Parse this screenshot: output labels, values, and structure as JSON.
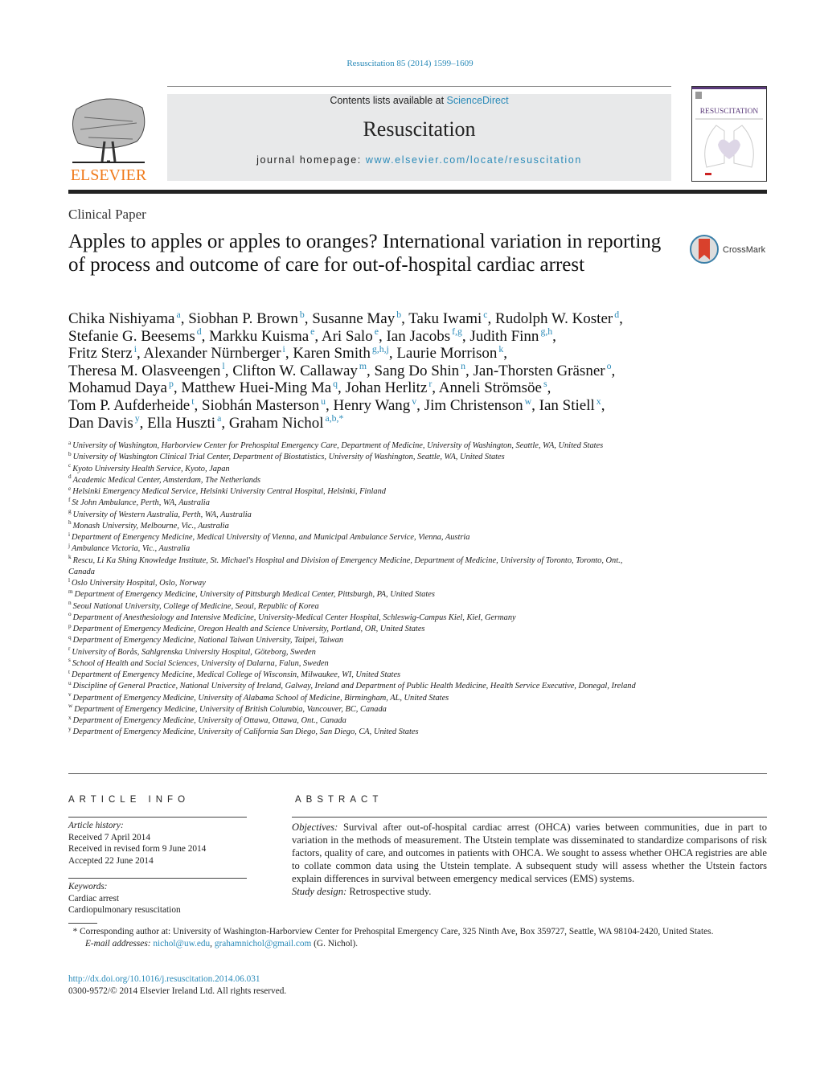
{
  "header": {
    "citation": "Resuscitation 85 (2014) 1599–1609",
    "contents_prefix": "Contents lists available at ",
    "contents_link": "ScienceDirect",
    "journal_title": "Resuscitation",
    "homepage_prefix": "journal homepage: ",
    "homepage_link": "www.elsevier.com/locate/resuscitation",
    "publisher_logo": "ELSEVIER",
    "cover_title": "RESUSCITATION"
  },
  "article": {
    "section": "Clinical Paper",
    "title": "Apples to apples or apples to oranges? International variation in reporting of process and outcome of care for out-of-hospital cardiac arrest",
    "crossmark": "CrossMark"
  },
  "authors": [
    [
      {
        "name": "Chika Nishiyama",
        "sup": "a"
      },
      {
        "name": "Siobhan P. Brown",
        "sup": "b"
      },
      {
        "name": "Susanne May",
        "sup": "b"
      },
      {
        "name": "Taku Iwami",
        "sup": "c"
      },
      {
        "name": "Rudolph W. Koster",
        "sup": "d"
      }
    ],
    [
      {
        "name": "Stefanie G. Beesems",
        "sup": "d"
      },
      {
        "name": "Markku Kuisma",
        "sup": "e"
      },
      {
        "name": "Ari Salo",
        "sup": "e"
      },
      {
        "name": "Ian Jacobs",
        "sup": "f,g"
      },
      {
        "name": "Judith Finn",
        "sup": "g,h"
      }
    ],
    [
      {
        "name": "Fritz Sterz",
        "sup": "i"
      },
      {
        "name": "Alexander Nürnberger",
        "sup": "i"
      },
      {
        "name": "Karen Smith",
        "sup": "g,h,j"
      },
      {
        "name": "Laurie Morrison",
        "sup": "k"
      }
    ],
    [
      {
        "name": "Theresa M. Olasveengen",
        "sup": "l"
      },
      {
        "name": "Clifton W. Callaway",
        "sup": "m"
      },
      {
        "name": "Sang Do Shin",
        "sup": "n"
      },
      {
        "name": "Jan-Thorsten Gräsner",
        "sup": "o"
      }
    ],
    [
      {
        "name": "Mohamud Daya",
        "sup": "p"
      },
      {
        "name": "Matthew Huei-Ming Ma",
        "sup": "q"
      },
      {
        "name": "Johan Herlitz",
        "sup": "r"
      },
      {
        "name": "Anneli Strömsöe",
        "sup": "s"
      }
    ],
    [
      {
        "name": "Tom P. Aufderheide",
        "sup": "t"
      },
      {
        "name": "Siobhán Masterson",
        "sup": "u"
      },
      {
        "name": "Henry Wang",
        "sup": "v"
      },
      {
        "name": "Jim Christenson",
        "sup": "w"
      },
      {
        "name": "Ian Stiell",
        "sup": "x"
      }
    ],
    [
      {
        "name": "Dan Davis",
        "sup": "y"
      },
      {
        "name": "Ella Huszti",
        "sup": "a"
      },
      {
        "name": "Graham Nichol",
        "sup": "a,b,*"
      }
    ]
  ],
  "affiliations": [
    {
      "letter": "a",
      "text": "University of Washington, Harborview Center for Prehospital Emergency Care, Department of Medicine, University of Washington, Seattle, WA, United States"
    },
    {
      "letter": "b",
      "text": "University of Washington Clinical Trial Center, Department of Biostatistics, University of Washington, Seattle, WA, United States"
    },
    {
      "letter": "c",
      "text": "Kyoto University Health Service, Kyoto, Japan"
    },
    {
      "letter": "d",
      "text": "Academic Medical Center, Amsterdam, The Netherlands"
    },
    {
      "letter": "e",
      "text": "Helsinki Emergency Medical Service, Helsinki University Central Hospital, Helsinki, Finland"
    },
    {
      "letter": "f",
      "text": "St John Ambulance, Perth, WA, Australia"
    },
    {
      "letter": "g",
      "text": "University of Western Australia, Perth, WA, Australia"
    },
    {
      "letter": "h",
      "text": "Monash University, Melbourne, Vic., Australia"
    },
    {
      "letter": "i",
      "text": "Department of Emergency Medicine, Medical University of Vienna, and Municipal Ambulance Service, Vienna, Austria"
    },
    {
      "letter": "j",
      "text": "Ambulance Victoria, Vic., Australia"
    },
    {
      "letter": "k",
      "text": "Rescu, Li Ka Shing Knowledge Institute, St. Michael's Hospital and Division of Emergency Medicine, Department of Medicine, University of Toronto, Toronto, Ont., Canada"
    },
    {
      "letter": "l",
      "text": "Oslo University Hospital, Oslo, Norway"
    },
    {
      "letter": "m",
      "text": "Department of Emergency Medicine, University of Pittsburgh Medical Center, Pittsburgh, PA, United States"
    },
    {
      "letter": "n",
      "text": "Seoul National University, College of Medicine, Seoul, Republic of Korea"
    },
    {
      "letter": "o",
      "text": "Department of Anesthesiology and Intensive Medicine, University-Medical Center Hospital, Schleswig-Campus Kiel, Kiel, Germany"
    },
    {
      "letter": "p",
      "text": "Department of Emergency Medicine, Oregon Health and Science University, Portland, OR, United States"
    },
    {
      "letter": "q",
      "text": "Department of Emergency Medicine, National Taiwan University, Taipei, Taiwan"
    },
    {
      "letter": "r",
      "text": "University of Borås, Sahlgrenska University Hospital, Göteborg, Sweden"
    },
    {
      "letter": "s",
      "text": "School of Health and Social Sciences, University of Dalarna, Falun, Sweden"
    },
    {
      "letter": "t",
      "text": "Department of Emergency Medicine, Medical College of Wisconsin, Milwaukee, WI, United States"
    },
    {
      "letter": "u",
      "text": "Discipline of General Practice, National University of Ireland, Galway, Ireland and Department of Public Health Medicine, Health Service Executive, Donegal, Ireland"
    },
    {
      "letter": "v",
      "text": "Department of Emergency Medicine, University of Alabama School of Medicine, Birmingham, AL, United States"
    },
    {
      "letter": "w",
      "text": "Department of Emergency Medicine, University of British Columbia, Vancouver, BC, Canada"
    },
    {
      "letter": "x",
      "text": "Department of Emergency Medicine, University of Ottawa, Ottawa, Ont., Canada"
    },
    {
      "letter": "y",
      "text": "Department of Emergency Medicine, University of California San Diego, San Diego, CA, United States"
    }
  ],
  "article_info": {
    "heading": "ARTICLE INFO",
    "history_label": "Article history:",
    "received": "Received 7 April 2014",
    "revised": "Received in revised form 9 June 2014",
    "accepted": "Accepted 22 June 2014",
    "keywords_label": "Keywords:",
    "keywords": [
      "Cardiac arrest",
      "Cardiopulmonary resuscitation"
    ]
  },
  "abstract": {
    "heading": "ABSTRACT",
    "objectives_label": "Objectives:",
    "objectives": " Survival after out-of-hospital cardiac arrest (OHCA) varies between communities, due in part to variation in the methods of measurement. The Utstein template was disseminated to standardize comparisons of risk factors, quality of care, and outcomes in patients with OHCA. We sought to assess whether OHCA registries are able to collate common data using the Utstein template. A subsequent study will assess whether the Utstein factors explain differences in survival between emergency medical services (EMS) systems.",
    "design_label": "Study design:",
    "design": " Retrospective study."
  },
  "footnote": {
    "marker": "*",
    "corresponding": " Corresponding author at: University of Washington-Harborview Center for Prehospital Emergency Care, 325 Ninth Ave, Box 359727, Seattle, WA 98104-2420, United States.",
    "email_label": "E-mail addresses:",
    "email1": "nichol@uw.edu",
    "sep": ", ",
    "email2": "grahamnichol@gmail.com",
    "email_suffix": " (G. Nichol)."
  },
  "doi": {
    "link": "http://dx.doi.org/10.1016/j.resuscitation.2014.06.031",
    "copyright": "0300-9572/© 2014 Elsevier Ireland Ltd. All rights reserved."
  },
  "colors": {
    "link": "#2a8ab8",
    "elsevier_orange": "#f07a1a",
    "banner_bg": "#e8e9ea"
  }
}
